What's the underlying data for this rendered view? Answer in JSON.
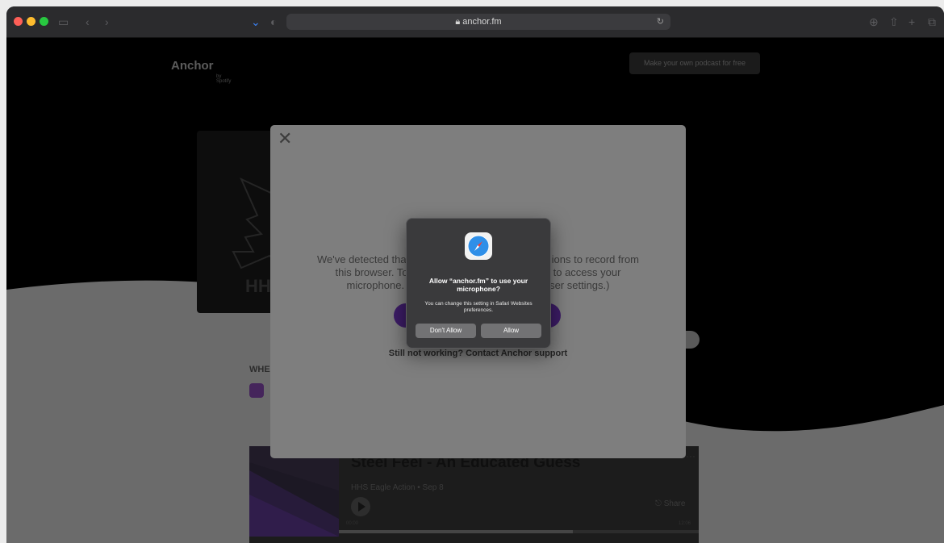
{
  "browser": {
    "url": "anchor.fm",
    "colors": {
      "close": "#fe5f57",
      "minimize": "#febc2e",
      "zoom": "#28c840"
    },
    "icons": [
      "sidebar-icon",
      "back-icon",
      "forward-icon",
      "shield-icon",
      "privacy-icon",
      "reload-icon",
      "download-icon",
      "share-icon",
      "new-tab-icon",
      "tabs-icon"
    ]
  },
  "page": {
    "logo": {
      "name": "Anchor",
      "by": "by Spotify"
    },
    "cta_label": "Make your own podcast for free",
    "when_label": "WHE"
  },
  "episode": {
    "title": "Steel Feel - An Educated Guess",
    "meta": "HHS Eagle Action • Sep 8",
    "share_label": "Share",
    "time_start": "00:00",
    "time_end": "12:06",
    "progress": 0.65
  },
  "modal": {
    "message_line1": "We've detected tha",
    "message_line1b": "ions to record from",
    "message_line2": "this browser. To",
    "message_line2b": "to access your",
    "message_line3": "microphone.",
    "message_line3b": "ser settings.)",
    "support_link": "Still not working? Contact Anchor support"
  },
  "permission_alert": {
    "title": "Allow “anchor.fm” to use your microphone?",
    "body": "You can change this setting in Safari Websites preferences.",
    "deny_label": "Don't Allow",
    "allow_label": "Allow"
  }
}
